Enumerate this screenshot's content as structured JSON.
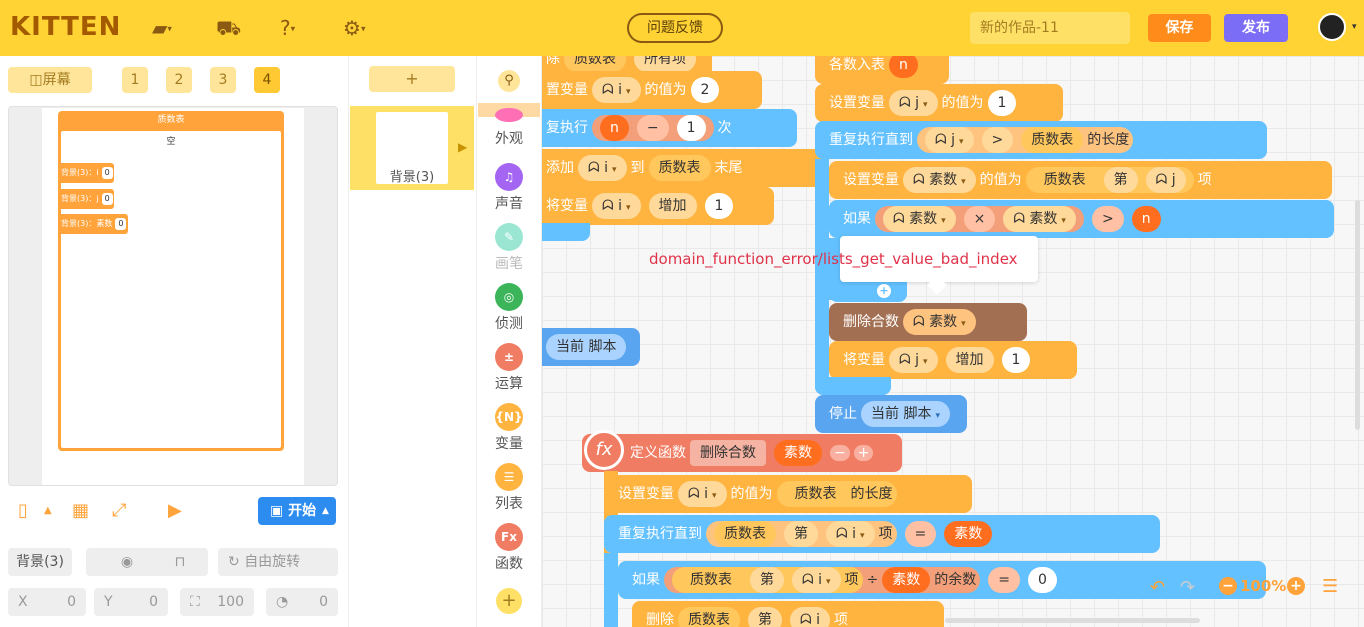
{
  "app": {
    "logo": "KITTEN"
  },
  "topbar": {
    "feedback": "问题反馈",
    "project_name": "新的作品-11",
    "save": "保存",
    "publish": "发布"
  },
  "stage_toolbar": {
    "screen_label": "屏幕",
    "screens": [
      "1",
      "2",
      "3",
      "4"
    ],
    "selected_screen": "4"
  },
  "stage": {
    "list_title": "质数表",
    "list_empty": "空",
    "monitors": [
      {
        "label": "背景(3)：i",
        "value": "0"
      },
      {
        "label": "背景(3)：j",
        "value": "0"
      },
      {
        "label": "背景(3)：素数",
        "value": "0"
      }
    ],
    "start_button": "开始"
  },
  "props": {
    "sprite_name": "背景(3)",
    "rotation": "自由旋转",
    "x_label": "X",
    "x_value": "0",
    "y_label": "Y",
    "y_value": "0",
    "size_value": "100",
    "direction_value": "0"
  },
  "sprites": {
    "add": "+",
    "background_label": "背景(3)"
  },
  "categories": [
    {
      "label": "外观",
      "color": "#ff6fb5",
      "icon": "appearance-icon"
    },
    {
      "label": "声音",
      "color": "#a466f2",
      "icon": "sound-icon"
    },
    {
      "label": "画笔",
      "color": "#7ee0c8",
      "icon": "pen-icon"
    },
    {
      "label": "侦测",
      "color": "#3cb55a",
      "icon": "sensing-icon"
    },
    {
      "label": "运算",
      "color": "#f07c63",
      "icon": "operator-icon"
    },
    {
      "label": "变量",
      "color": "#ffb440",
      "icon": "variable-icon"
    },
    {
      "label": "列表",
      "color": "#ffb440",
      "icon": "list-icon"
    },
    {
      "label": "函数",
      "color": "#f07c63",
      "icon": "function-icon"
    }
  ],
  "blocks": {
    "b1_a": "除",
    "b1_b": "质数表",
    "b1_c": "所有项",
    "b2_a": "置变量",
    "b2_var": "i",
    "b2_b": "的值为",
    "b2_val": "2",
    "b3_a": "复执行",
    "b3_n": "n",
    "b3_op": "−",
    "b3_val": "1",
    "b3_b": "次",
    "b4_a": "添加",
    "b4_var": "i",
    "b4_b": "到",
    "b4_list": "质数表",
    "b4_c": "末尾",
    "b5_a": "将变量",
    "b5_var": "i",
    "b5_b": "增加",
    "b5_val": "1",
    "b6_a": "当前 脚本",
    "r1_a": "各数入表",
    "r1_n": "n",
    "r2_a": "设置变量",
    "r2_var": "j",
    "r2_b": "的值为",
    "r2_val": "1",
    "r3_a": "重复执行直到",
    "r3_var": "j",
    "r3_op": ">",
    "r3_list": "质数表",
    "r3_b": "的长度",
    "r4_a": "设置变量",
    "r4_var": "素数",
    "r4_b": "的值为",
    "r4_list": "质数表",
    "r4_c": "第",
    "r4_idx": "j",
    "r4_d": "项",
    "r5_a": "如果",
    "r5_v1": "素数",
    "r5_op": "×",
    "r5_v2": "素数",
    "r5_cmp": ">",
    "r5_n": "n",
    "r6_a": "删除合数",
    "r6_var": "素数",
    "r7_a": "将变量",
    "r7_var": "j",
    "r7_b": "增加",
    "r7_val": "1",
    "r8_a": "停止",
    "r8_b": "当前 脚本",
    "f1_a": "定义函数",
    "f1_name": "删除合数",
    "f1_param": "素数",
    "f2_a": "设置变量",
    "f2_var": "i",
    "f2_b": "的值为",
    "f2_list": "质数表",
    "f2_c": "的长度",
    "f3_a": "重复执行直到",
    "f3_list": "质数表",
    "f3_b": "第",
    "f3_var": "i",
    "f3_c": "项",
    "f3_op": "=",
    "f3_val": "素数",
    "f4_a": "如果",
    "f4_list": "质数表",
    "f4_b": "第",
    "f4_var": "i",
    "f4_c": "项",
    "f4_div": "÷",
    "f4_v": "素数",
    "f4_d": "的余数",
    "f4_val": "0",
    "f5_a": "删除",
    "f5_list": "质数表",
    "f5_b": "第",
    "f5_var": "i",
    "f5_c": "项"
  },
  "error_tooltip": "domain_function_error/lists_get_value_bad_index",
  "zoom": {
    "value": "100%"
  }
}
